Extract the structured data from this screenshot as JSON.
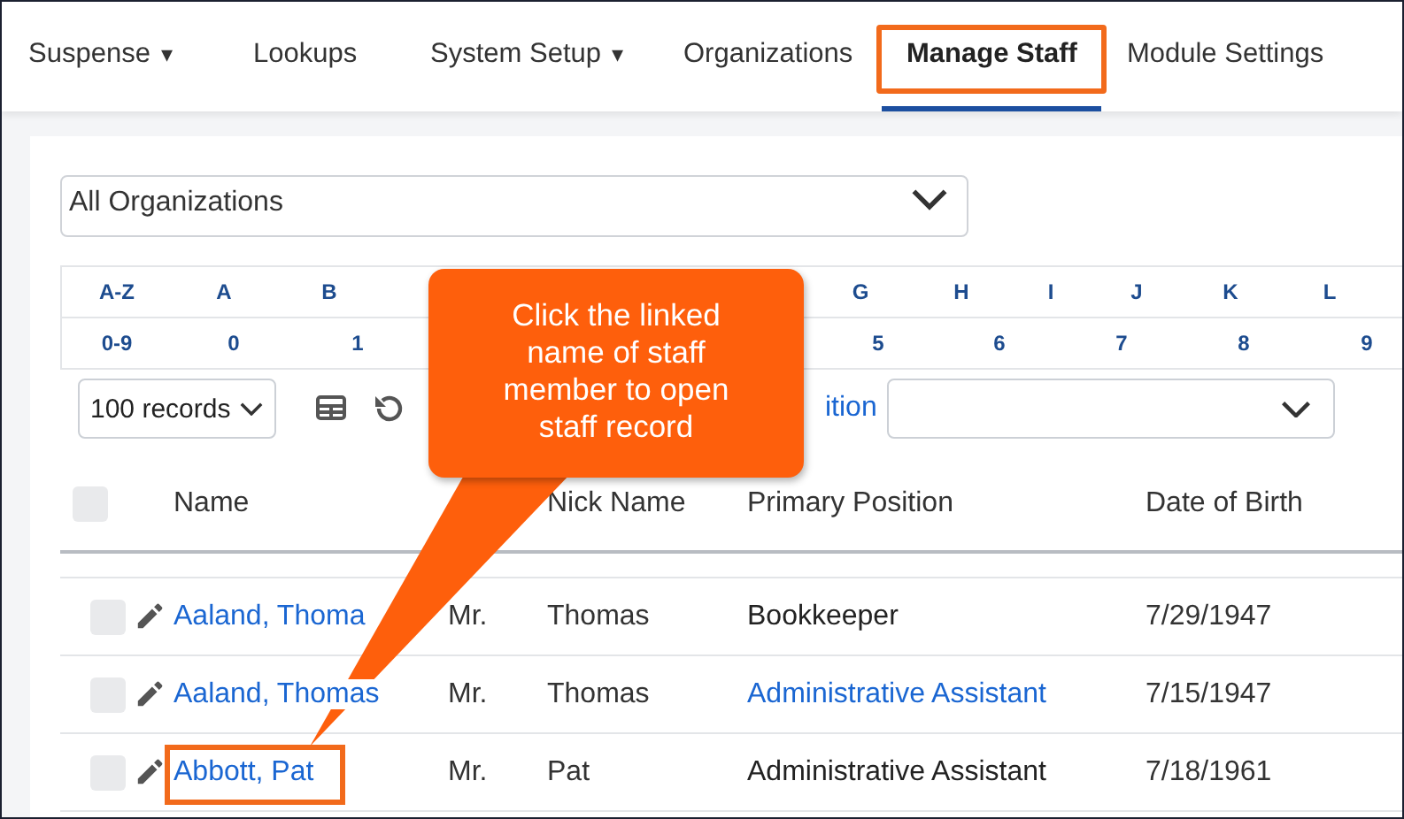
{
  "nav": {
    "tabs": [
      {
        "label": "Suspense",
        "dropdown": true,
        "selected": false,
        "highlighted": false
      },
      {
        "label": "Lookups",
        "dropdown": false,
        "selected": false,
        "highlighted": false
      },
      {
        "label": "System Setup",
        "dropdown": true,
        "selected": false,
        "highlighted": false
      },
      {
        "label": "Organizations",
        "dropdown": false,
        "selected": false,
        "highlighted": false
      },
      {
        "label": "Manage Staff",
        "dropdown": false,
        "selected": true,
        "highlighted": true
      },
      {
        "label": "Module Settings",
        "dropdown": false,
        "selected": false,
        "highlighted": false
      }
    ],
    "dropdown_mark": "▾"
  },
  "organization_select": {
    "value": "All Organizations"
  },
  "alpha_index": {
    "letters": {
      "before": [
        "A-Z",
        "A",
        "B"
      ],
      "after": [
        "G",
        "H",
        "I",
        "J",
        "K",
        "L"
      ]
    },
    "digits": {
      "before": [
        "0-9",
        "0",
        "1"
      ],
      "after": [
        "5",
        "6",
        "7",
        "8",
        "9"
      ]
    }
  },
  "toolbar": {
    "page_size": "100 records",
    "position_link": "ition"
  },
  "table": {
    "select_all_checked": false,
    "columns": [
      "Name",
      "Nick Name",
      "Primary Position",
      "Date of Birth"
    ],
    "rows": [
      {
        "name": "Aaland, Thoma",
        "title": "Mr.",
        "nick_name": "Thomas",
        "position": "Bookkeeper",
        "position_linked": false,
        "birth_date": "7/29/1947",
        "highlighted": false,
        "checked": false
      },
      {
        "name": "Aaland, Thomas",
        "title": "Mr.",
        "nick_name": "Thomas",
        "position": "Administrative Assistant",
        "position_linked": true,
        "birth_date": "7/15/1947",
        "highlighted": false,
        "checked": false
      },
      {
        "name": "Abbott, Pat",
        "title": "Mr.",
        "nick_name": "Pat",
        "position": "Administrative Assistant",
        "position_linked": false,
        "birth_date": "7/18/1961",
        "highlighted": true,
        "checked": false
      }
    ]
  },
  "callout": {
    "text": "Click the linked name of staff member to open staff record"
  }
}
